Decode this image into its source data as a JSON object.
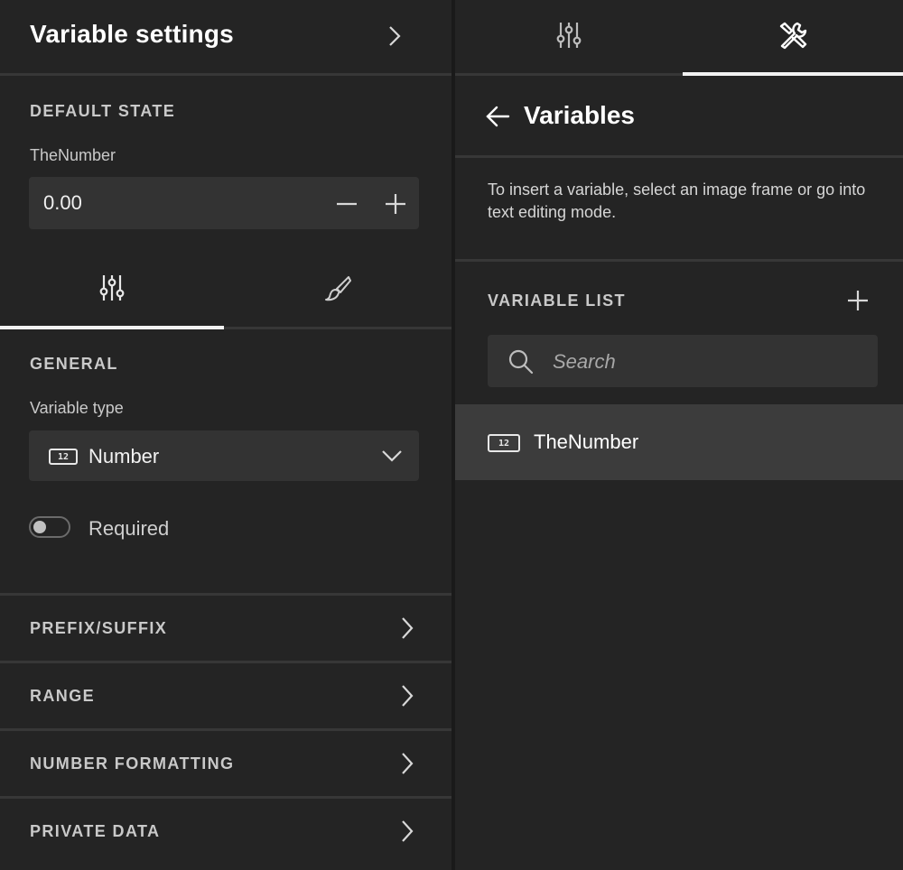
{
  "left": {
    "title": "Variable settings",
    "default_state": {
      "label": "DEFAULT STATE",
      "variable_name": "TheNumber",
      "value": "0.00"
    },
    "tabs": [
      {
        "icon": "sliders-icon",
        "active": true
      },
      {
        "icon": "brush-icon",
        "active": false
      }
    ],
    "general": {
      "label": "GENERAL",
      "variable_type_label": "Variable type",
      "variable_type_value": "Number",
      "variable_type_badge": "12",
      "required_label": "Required",
      "required": false
    },
    "accordions": [
      {
        "label": "PREFIX/SUFFIX"
      },
      {
        "label": "RANGE"
      },
      {
        "label": "NUMBER FORMATTING"
      },
      {
        "label": "PRIVATE DATA"
      }
    ]
  },
  "right": {
    "tabs": [
      {
        "icon": "sliders-icon",
        "active": false
      },
      {
        "icon": "tools-icon",
        "active": true
      }
    ],
    "title": "Variables",
    "description": "To insert a variable, select an image frame or go into text editing mode.",
    "list_label": "VARIABLE LIST",
    "search_placeholder": "Search",
    "items": [
      {
        "label": "TheNumber",
        "badge": "12"
      }
    ]
  },
  "colors": {
    "background": "#242424",
    "field": "#333333",
    "selected_row": "#3c3c3c",
    "accent_underline": "#f2f2f2"
  }
}
